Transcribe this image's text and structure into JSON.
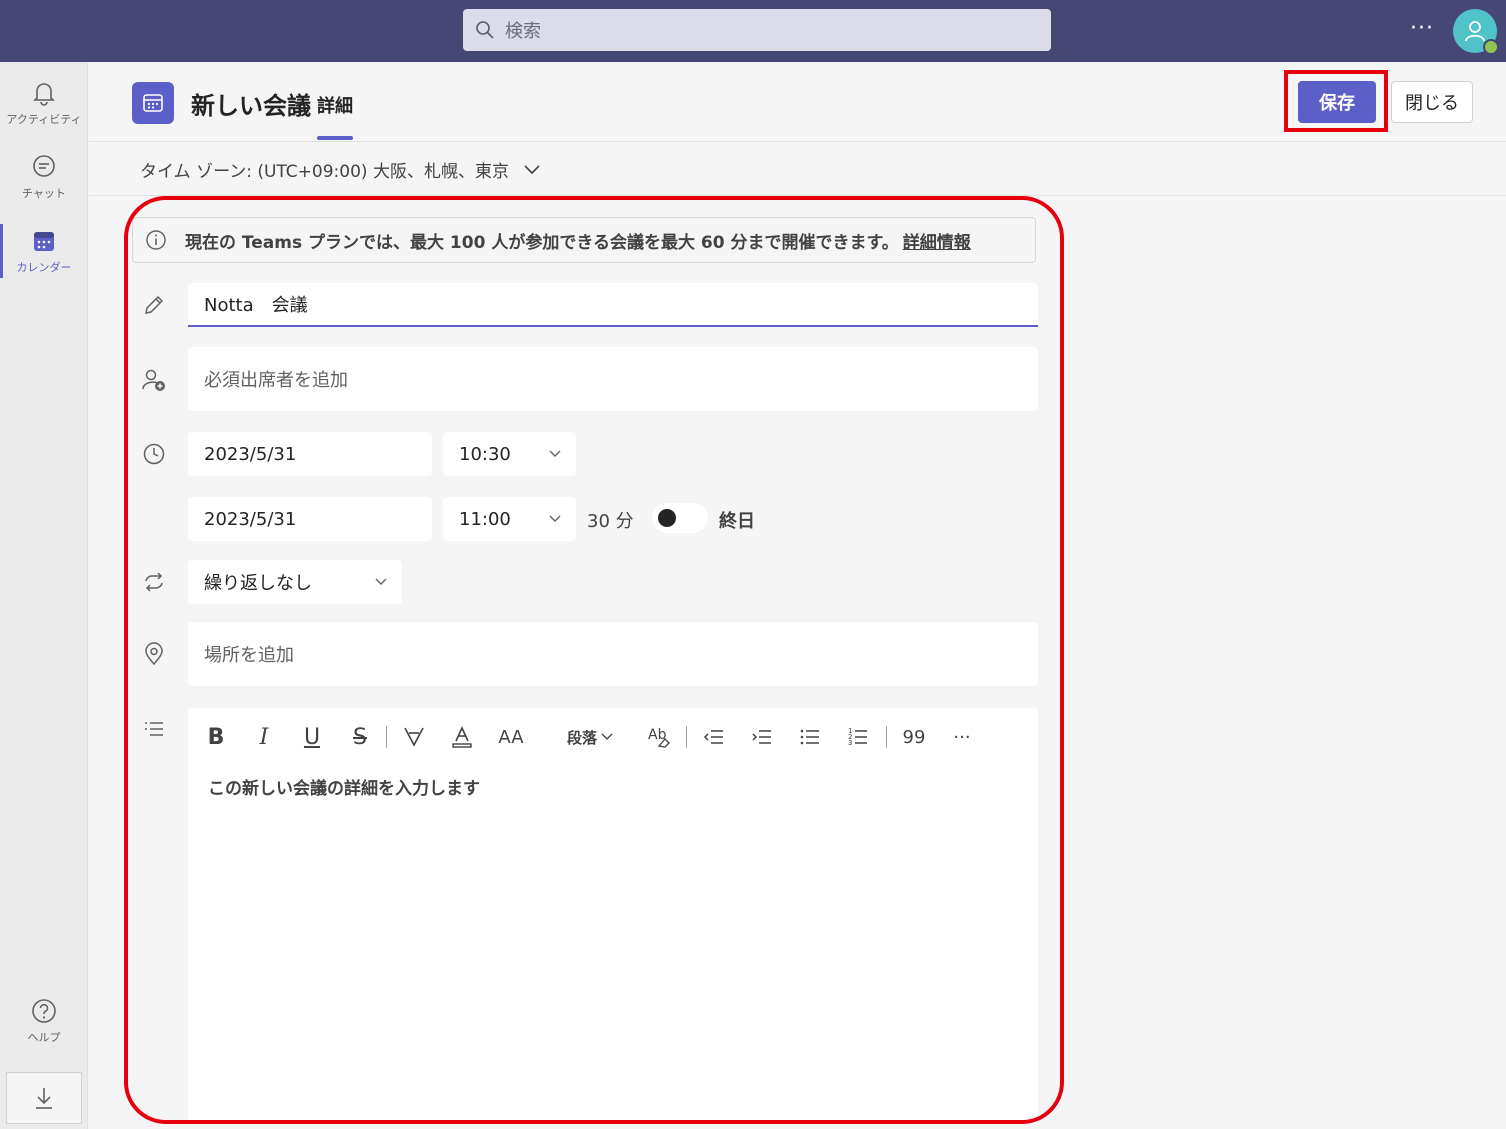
{
  "topbar": {
    "search_placeholder": "検索",
    "more_label": "···"
  },
  "rail": {
    "items": [
      {
        "label": "アクティビティ",
        "icon": "bell-icon"
      },
      {
        "label": "チャット",
        "icon": "chat-icon"
      },
      {
        "label": "カレンダー",
        "icon": "calendar-icon"
      }
    ],
    "help_label": "ヘルプ"
  },
  "header": {
    "title": "新しい会議",
    "tab": "詳細",
    "save_label": "保存",
    "close_label": "閉じる"
  },
  "timezone": {
    "label": "タイム ゾーン: (UTC+09:00) 大阪、札幌、東京"
  },
  "banner": {
    "text": "現在の Teams プランでは、最大 100 人が参加できる会議を最大 60 分まで開催できます。",
    "link": "詳細情報"
  },
  "form": {
    "title_value": "Notta　会議",
    "attendees_placeholder": "必須出席者を追加",
    "start_date": "2023/5/31",
    "start_time": "10:30",
    "end_date": "2023/5/31",
    "end_time": "11:00",
    "duration": "30 分",
    "allday_label": "終日",
    "repeat": "繰り返しなし",
    "location_placeholder": "場所を追加",
    "details_placeholder": "この新しい会議の詳細を入力します"
  },
  "toolbar": {
    "bold": "B",
    "italic": "I",
    "underline": "U",
    "strike": "S",
    "font_size": "AA",
    "paragraph": "段落",
    "quote": "99",
    "more": "···"
  },
  "colors": {
    "brand": "#5b5fc7",
    "topbar": "#464775",
    "highlight": "#e6000d"
  }
}
